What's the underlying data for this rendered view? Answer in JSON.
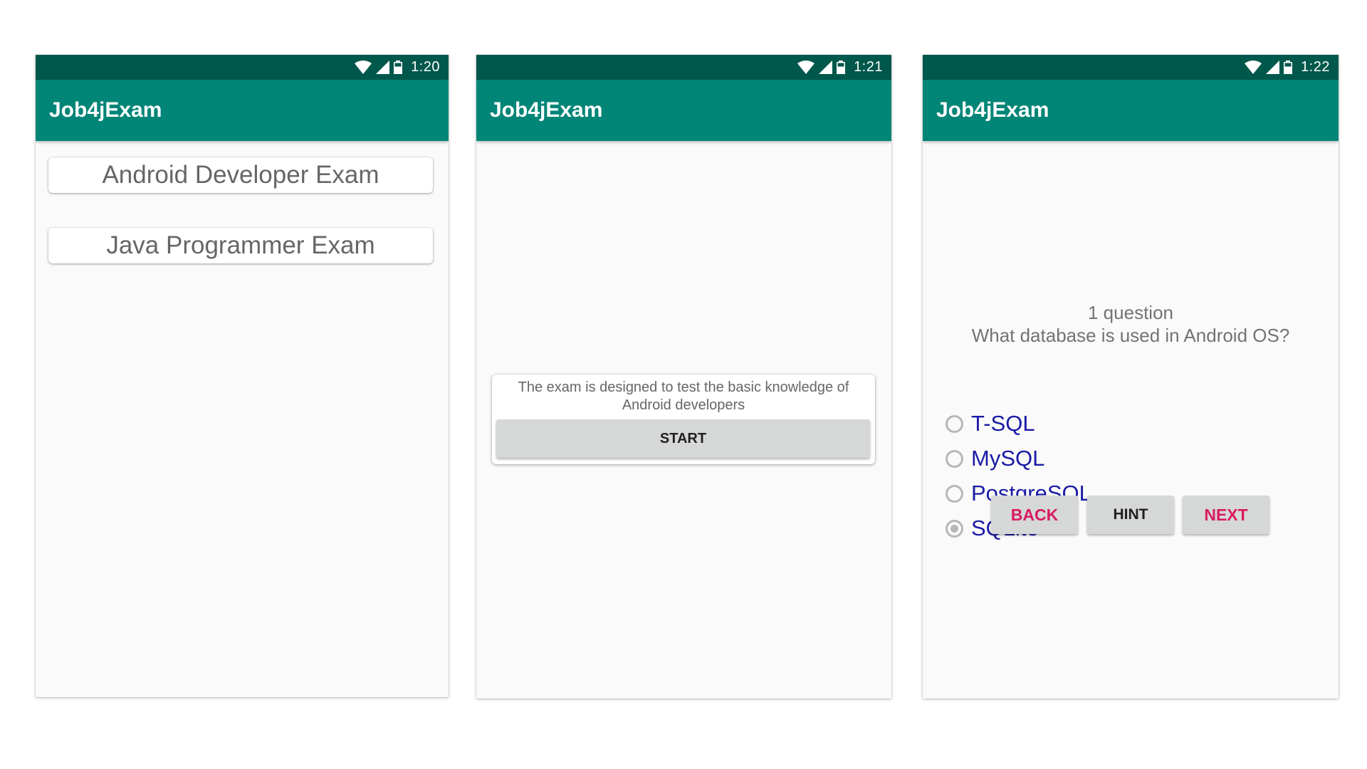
{
  "phones": [
    {
      "status": {
        "time": "1:20"
      },
      "app_bar": {
        "title": "Job4jExam"
      },
      "exams": [
        "Android Developer Exam",
        "Java Programmer Exam"
      ]
    },
    {
      "status": {
        "time": "1:21"
      },
      "app_bar": {
        "title": "Job4jExam"
      },
      "card": {
        "description": "The exam is designed to test the basic knowledge of Android developers",
        "start_label": "START"
      }
    },
    {
      "status": {
        "time": "1:22"
      },
      "app_bar": {
        "title": "Job4jExam"
      },
      "question": {
        "number": "1 question",
        "text": "What database is used in Android OS?",
        "options": [
          {
            "label": "T-SQL",
            "selected": false
          },
          {
            "label": "MySQL",
            "selected": false
          },
          {
            "label": "PostgreSQL",
            "selected": false
          },
          {
            "label": "SQLite",
            "selected": true
          }
        ]
      },
      "buttons": {
        "back": "BACK",
        "hint": "HINT",
        "next": "NEXT"
      }
    }
  ],
  "colors": {
    "status_bar": "#00574b",
    "app_bar": "#008577",
    "accent": "#d81b60",
    "option_text": "#1a1aa6"
  },
  "icons": [
    "wifi-icon",
    "signal-icon",
    "battery-icon"
  ]
}
